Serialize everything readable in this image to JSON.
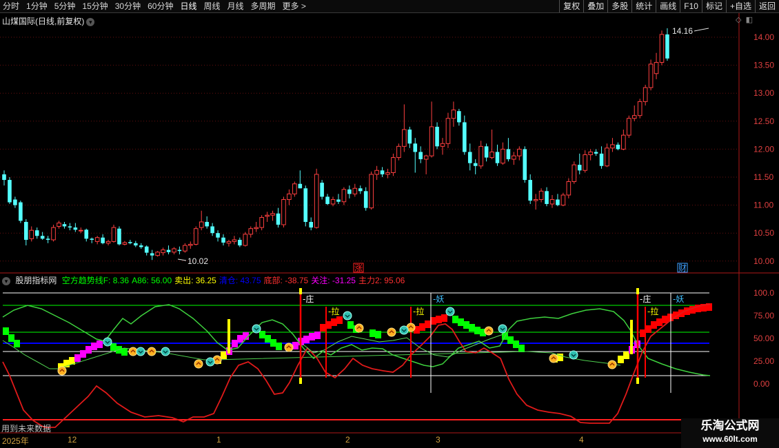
{
  "toolbar": {
    "tabs": [
      "分时",
      "1分钟",
      "5分钟",
      "15分钟",
      "30分钟",
      "60分钟",
      "日线",
      "周线",
      "月线",
      "多周期",
      "更多 >"
    ],
    "active_tab": "日线",
    "right_buttons": [
      "复权",
      "叠加",
      "多股",
      "统计",
      "画线",
      "F10",
      "标记",
      "+自选",
      "返回"
    ]
  },
  "kline": {
    "title": "山煤国际(日线,前复权)",
    "high_label": "14.16",
    "low_label": "10.02",
    "y_ticks": [
      "14.00",
      "13.50",
      "13.00",
      "12.50",
      "12.00",
      "11.50",
      "11.00",
      "10.50",
      "10.00"
    ],
    "markers": [
      {
        "text": "涨",
        "color": "#ff2020"
      },
      {
        "text": "财",
        "color": "#40a0ff"
      }
    ]
  },
  "indicator": {
    "name": "股朋指标网",
    "values": [
      {
        "text": "空方趋势线F: 8.36",
        "color": "#00ff00"
      },
      {
        "text": "A86: 56.00",
        "color": "#00ff00"
      },
      {
        "text": "卖出: 36.25",
        "color": "#ffff00"
      },
      {
        "text": "清仓: 43.75",
        "color": "#0000ff"
      },
      {
        "text": "底部: -38.75",
        "color": "#ff3030"
      },
      {
        "text": "关注: -31.25",
        "color": "#ff00ff"
      },
      {
        "text": "主力2: 95.06",
        "color": "#ff3030"
      }
    ],
    "y_ticks": [
      "100.0",
      "75.00",
      "50.00",
      "25.00",
      "0.00"
    ],
    "labels": [
      "庄",
      "拉",
      "拉",
      "妖",
      "庄",
      "拉",
      "妖"
    ]
  },
  "xaxis": {
    "labels": [
      "2025年",
      "12",
      "1",
      "2",
      "3",
      "4"
    ],
    "future_note": "用到未来数据"
  },
  "watermark": {
    "name": "乐淘公式网",
    "url": "www.60lt.com"
  },
  "colors": {
    "up": "#ff4040",
    "down": "#54ffff",
    "green_band": "#00ff00",
    "red_band": "#ff0000",
    "magenta_band": "#ff00ff",
    "yellow_band": "#ffff00"
  }
}
